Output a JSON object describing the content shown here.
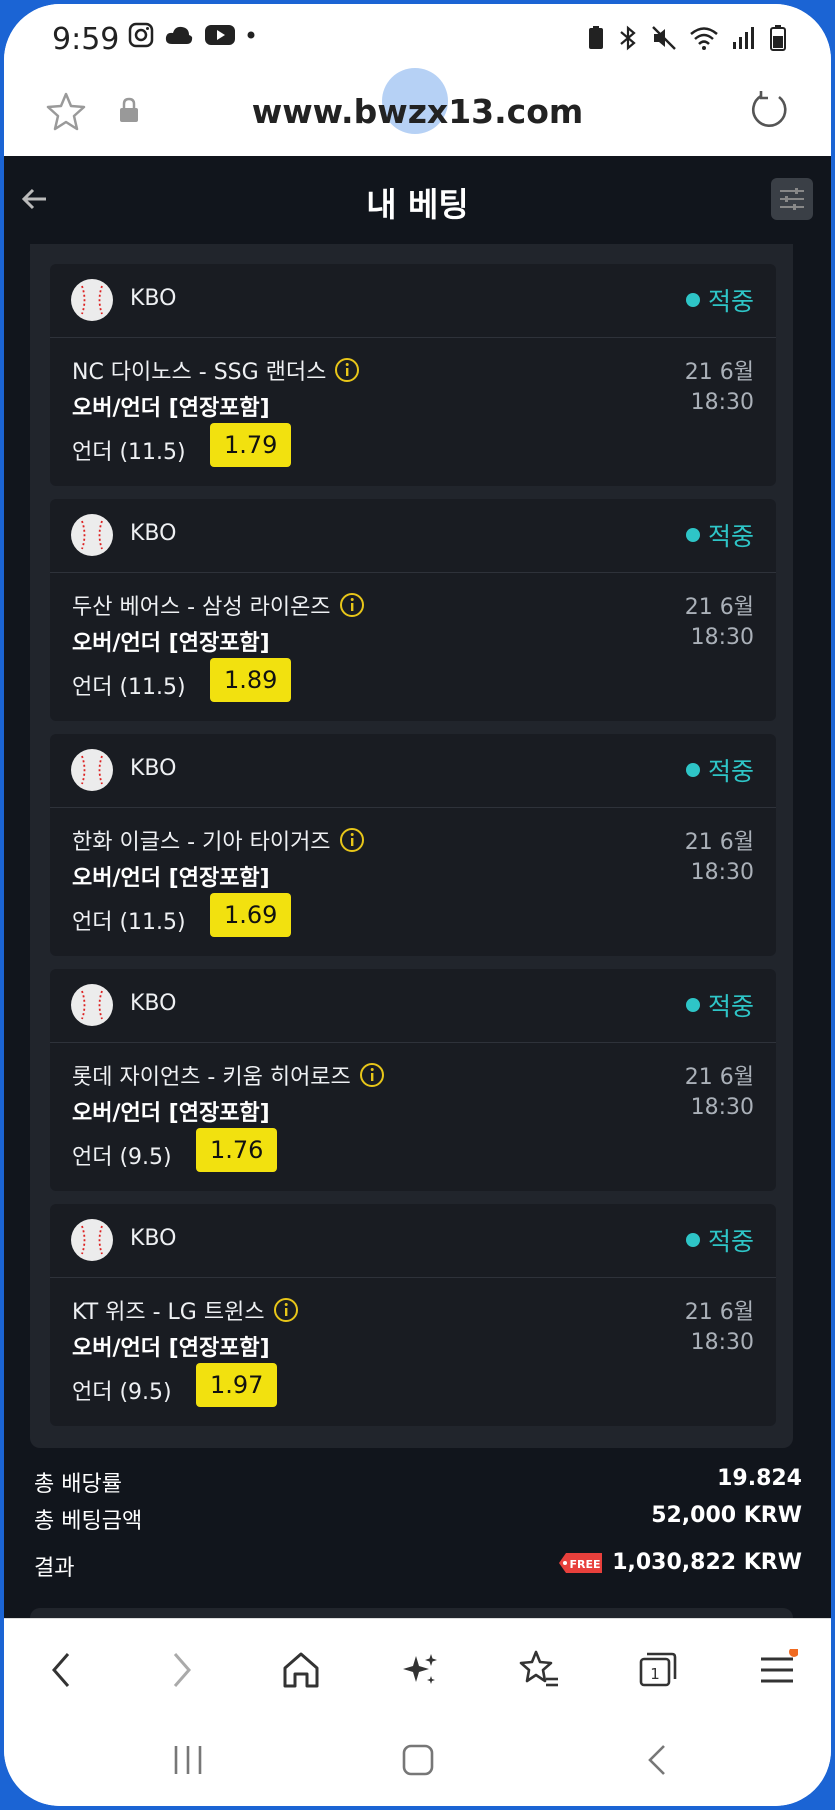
{
  "status_bar": {
    "time": "9:59"
  },
  "browser": {
    "url": "www.bwzx13.com"
  },
  "header": {
    "title": "내 베팅"
  },
  "bets": [
    {
      "league": "KBO",
      "status": "적중",
      "match": "NC 다이노스 - SSG 랜더스",
      "market": "오버/언더 [연장포함]",
      "date": "21 6월",
      "time": "18:30",
      "selection": "언더 (11.5)",
      "odds": "1.79"
    },
    {
      "league": "KBO",
      "status": "적중",
      "match": "두산 베어스 - 삼성 라이온즈",
      "market": "오버/언더 [연장포함]",
      "date": "21 6월",
      "time": "18:30",
      "selection": "언더 (11.5)",
      "odds": "1.89"
    },
    {
      "league": "KBO",
      "status": "적중",
      "match": "한화 이글스 - 기아 타이거즈",
      "market": "오버/언더 [연장포함]",
      "date": "21 6월",
      "time": "18:30",
      "selection": "언더 (11.5)",
      "odds": "1.69"
    },
    {
      "league": "KBO",
      "status": "적중",
      "match": "롯데 자이언츠 - 키움 히어로즈",
      "market": "오버/언더 [연장포함]",
      "date": "21 6월",
      "time": "18:30",
      "selection": "언더 (9.5)",
      "odds": "1.76"
    },
    {
      "league": "KBO",
      "status": "적중",
      "match": "KT 위즈 - LG 트윈스",
      "market": "오버/언더 [연장포함]",
      "date": "21 6월",
      "time": "18:30",
      "selection": "언더 (9.5)",
      "odds": "1.97"
    }
  ],
  "summary": {
    "total_odds_label": "총 배당률",
    "total_odds": "19.824",
    "total_stake_label": "총 베팅금액",
    "total_stake": "52,000 KRW",
    "result_label": "결과",
    "result": "1,030,822 KRW",
    "free_tag": "FREE"
  },
  "bottom_nav": {
    "tab_count": "1",
    "icons": [
      "back-icon",
      "forward-icon",
      "home-icon",
      "sparkle-icon",
      "bookmarks-icon",
      "tabs-icon",
      "menu-icon"
    ]
  },
  "colors": {
    "background": "#11151c",
    "card": "#191c22",
    "status_won": "#2ec5c7",
    "odds_badge": "#f2e10f",
    "info_icon": "#e8c619"
  }
}
